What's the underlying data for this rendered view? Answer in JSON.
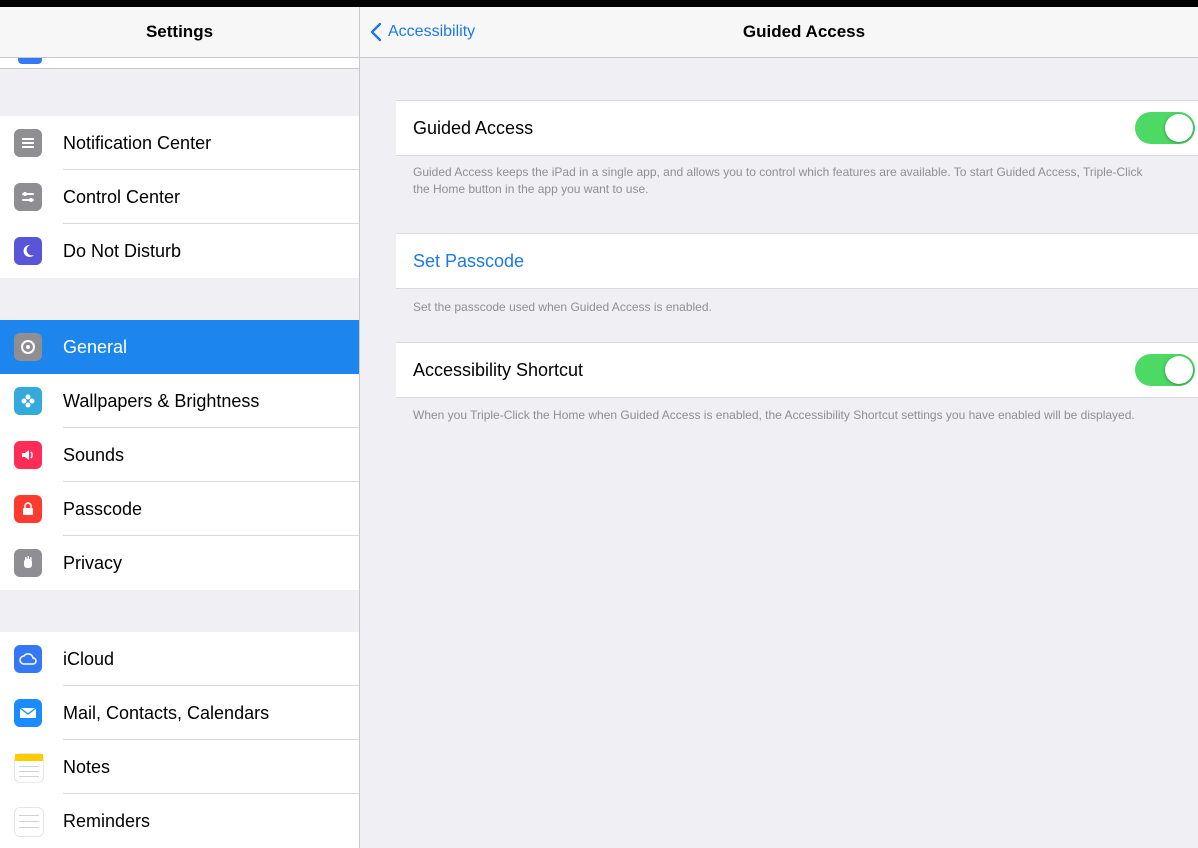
{
  "sidebar": {
    "title": "Settings",
    "groups": [
      [
        {
          "label": "Notification Center",
          "icon": "notification-center-icon",
          "color": "#8e8e93"
        },
        {
          "label": "Control Center",
          "icon": "control-center-icon",
          "color": "#8e8e93"
        },
        {
          "label": "Do Not Disturb",
          "icon": "moon-icon",
          "color": "#5856d6"
        }
      ],
      [
        {
          "label": "General",
          "icon": "gear-icon",
          "color": "#8e8e93",
          "selected": true
        },
        {
          "label": "Wallpapers & Brightness",
          "icon": "flower-icon",
          "color": "#34aadc"
        },
        {
          "label": "Sounds",
          "icon": "speaker-icon",
          "color": "#ff2d55"
        },
        {
          "label": "Passcode",
          "icon": "lock-icon",
          "color": "#ff3b30"
        },
        {
          "label": "Privacy",
          "icon": "hand-icon",
          "color": "#8e8e93"
        }
      ],
      [
        {
          "label": "iCloud",
          "icon": "cloud-icon",
          "color": "#3478f6"
        },
        {
          "label": "Mail, Contacts, Calendars",
          "icon": "mail-icon",
          "color": "#1a8cff"
        },
        {
          "label": "Notes",
          "icon": "notes-icon",
          "color": "#ffcc00"
        },
        {
          "label": "Reminders",
          "icon": "reminders-icon",
          "color": "#e5e5ea"
        }
      ]
    ]
  },
  "detail": {
    "back_label": "Accessibility",
    "title": "Guided Access",
    "guided_access": {
      "label": "Guided Access",
      "enabled": true,
      "footer": "Guided Access keeps the iPad in a single app, and allows you to control which features are available. To start Guided Access, Triple-Click the Home button in the app you want to use."
    },
    "set_passcode": {
      "label": "Set Passcode",
      "footer": "Set the passcode used when Guided Access is enabled."
    },
    "accessibility_shortcut": {
      "label": "Accessibility Shortcut",
      "enabled": true,
      "footer": "When you Triple-Click the Home when Guided Access is enabled, the Accessibility Shortcut settings you have enabled will be displayed."
    }
  },
  "colors": {
    "accent": "#1a7ae8",
    "selection": "#1c86ee",
    "toggle_on": "#4cd964",
    "background": "#efeff4"
  }
}
